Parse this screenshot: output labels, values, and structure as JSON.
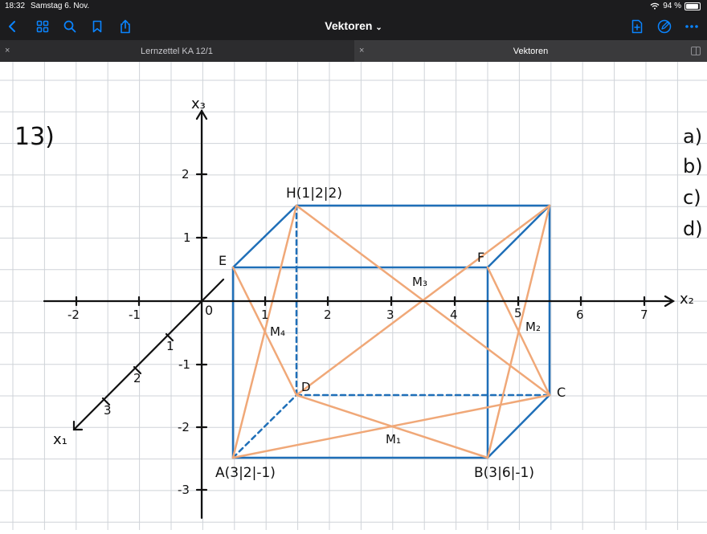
{
  "status_bar": {
    "time": "18:32",
    "date": "Samstag 6. Nov.",
    "battery": "94 %"
  },
  "toolbar": {
    "title": "Vektoren",
    "title_chevron": "⌄",
    "icons": [
      "back-chevron-icon",
      "thumbnails-grid-icon",
      "search-icon",
      "bookmark-icon",
      "share-icon",
      "add-page-icon",
      "pencil-annotate-icon",
      "more-icon"
    ],
    "accent": "#0a84ff"
  },
  "tabs": [
    {
      "label": "Lernzettel KA 12/1",
      "close": "×",
      "active": false
    },
    {
      "label": "Vektoren",
      "close": "×",
      "active": true
    }
  ],
  "note": {
    "exercise_label": "13)",
    "parts": [
      "a)",
      "b)",
      "c)",
      "d)"
    ],
    "axis_labels": {
      "x1": "x₁",
      "x2": "x₂",
      "x3": "x₃"
    },
    "origin_label": "0",
    "x2_ticks": [
      "-2",
      "-1",
      "1",
      "2",
      "3",
      "4",
      "5",
      "6",
      "7"
    ],
    "x3_ticks": [
      "2",
      "1",
      "-1",
      "-2",
      "-3"
    ],
    "x1_ticks": [
      "1",
      "2",
      "3"
    ],
    "points": {
      "A": "A(3|2|-1)",
      "B": "B(3|6|-1)",
      "C": "C",
      "D": "D",
      "E": "E",
      "F": "F",
      "H": "H(1|2|2)"
    },
    "midpoints": {
      "M1": "M₁",
      "M2": "M₂",
      "M3": "M₃",
      "M4": "M₄"
    },
    "colors": {
      "ink": "#111111",
      "box": "#1f6fb8",
      "diagonal": "#f0a878",
      "grid": "#cfd3d8"
    }
  }
}
